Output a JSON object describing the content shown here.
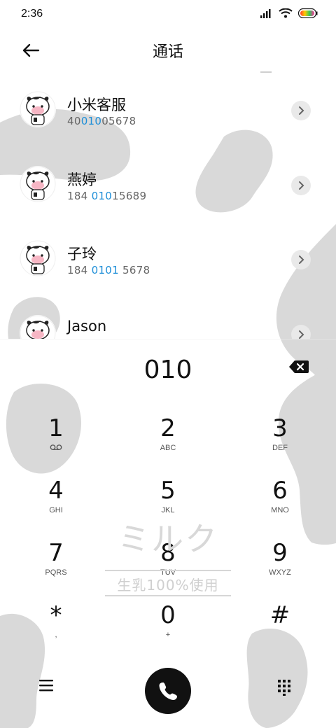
{
  "status_bar": {
    "time": "2:36"
  },
  "header": {
    "title": "通话",
    "back_icon": "arrow-left-icon"
  },
  "contacts": [
    {
      "name": "小米客服",
      "number_pre": "40",
      "number_hl": "010",
      "number_post": "05678"
    },
    {
      "name": "燕婷",
      "number_pre": "184 ",
      "number_hl": "010",
      "number_post": "15689"
    },
    {
      "name": "子玲",
      "number_pre": "184 ",
      "number_hl": "0101",
      "number_post": " 5678"
    },
    {
      "name": "Jason",
      "number_pre": "",
      "number_hl": "",
      "number_post": ""
    }
  ],
  "dialer": {
    "input": "010",
    "keys": [
      {
        "digit": "1",
        "letters": ""
      },
      {
        "digit": "2",
        "letters": "ABC"
      },
      {
        "digit": "3",
        "letters": "DEF"
      },
      {
        "digit": "4",
        "letters": "GHI"
      },
      {
        "digit": "5",
        "letters": "JKL"
      },
      {
        "digit": "6",
        "letters": "MNO"
      },
      {
        "digit": "7",
        "letters": "PQRS"
      },
      {
        "digit": "8",
        "letters": "TUV"
      },
      {
        "digit": "9",
        "letters": "WXYZ"
      },
      {
        "digit": "*",
        "letters": ","
      },
      {
        "digit": "0",
        "letters": "+"
      },
      {
        "digit": "#",
        "letters": ""
      }
    ]
  },
  "watermark": {
    "title": "ミルク",
    "subtitle": "生乳100%使用"
  },
  "colors": {
    "highlight": "#1f8fd8",
    "cow_spot": "#d9d9d9",
    "call_button": "#111111"
  }
}
